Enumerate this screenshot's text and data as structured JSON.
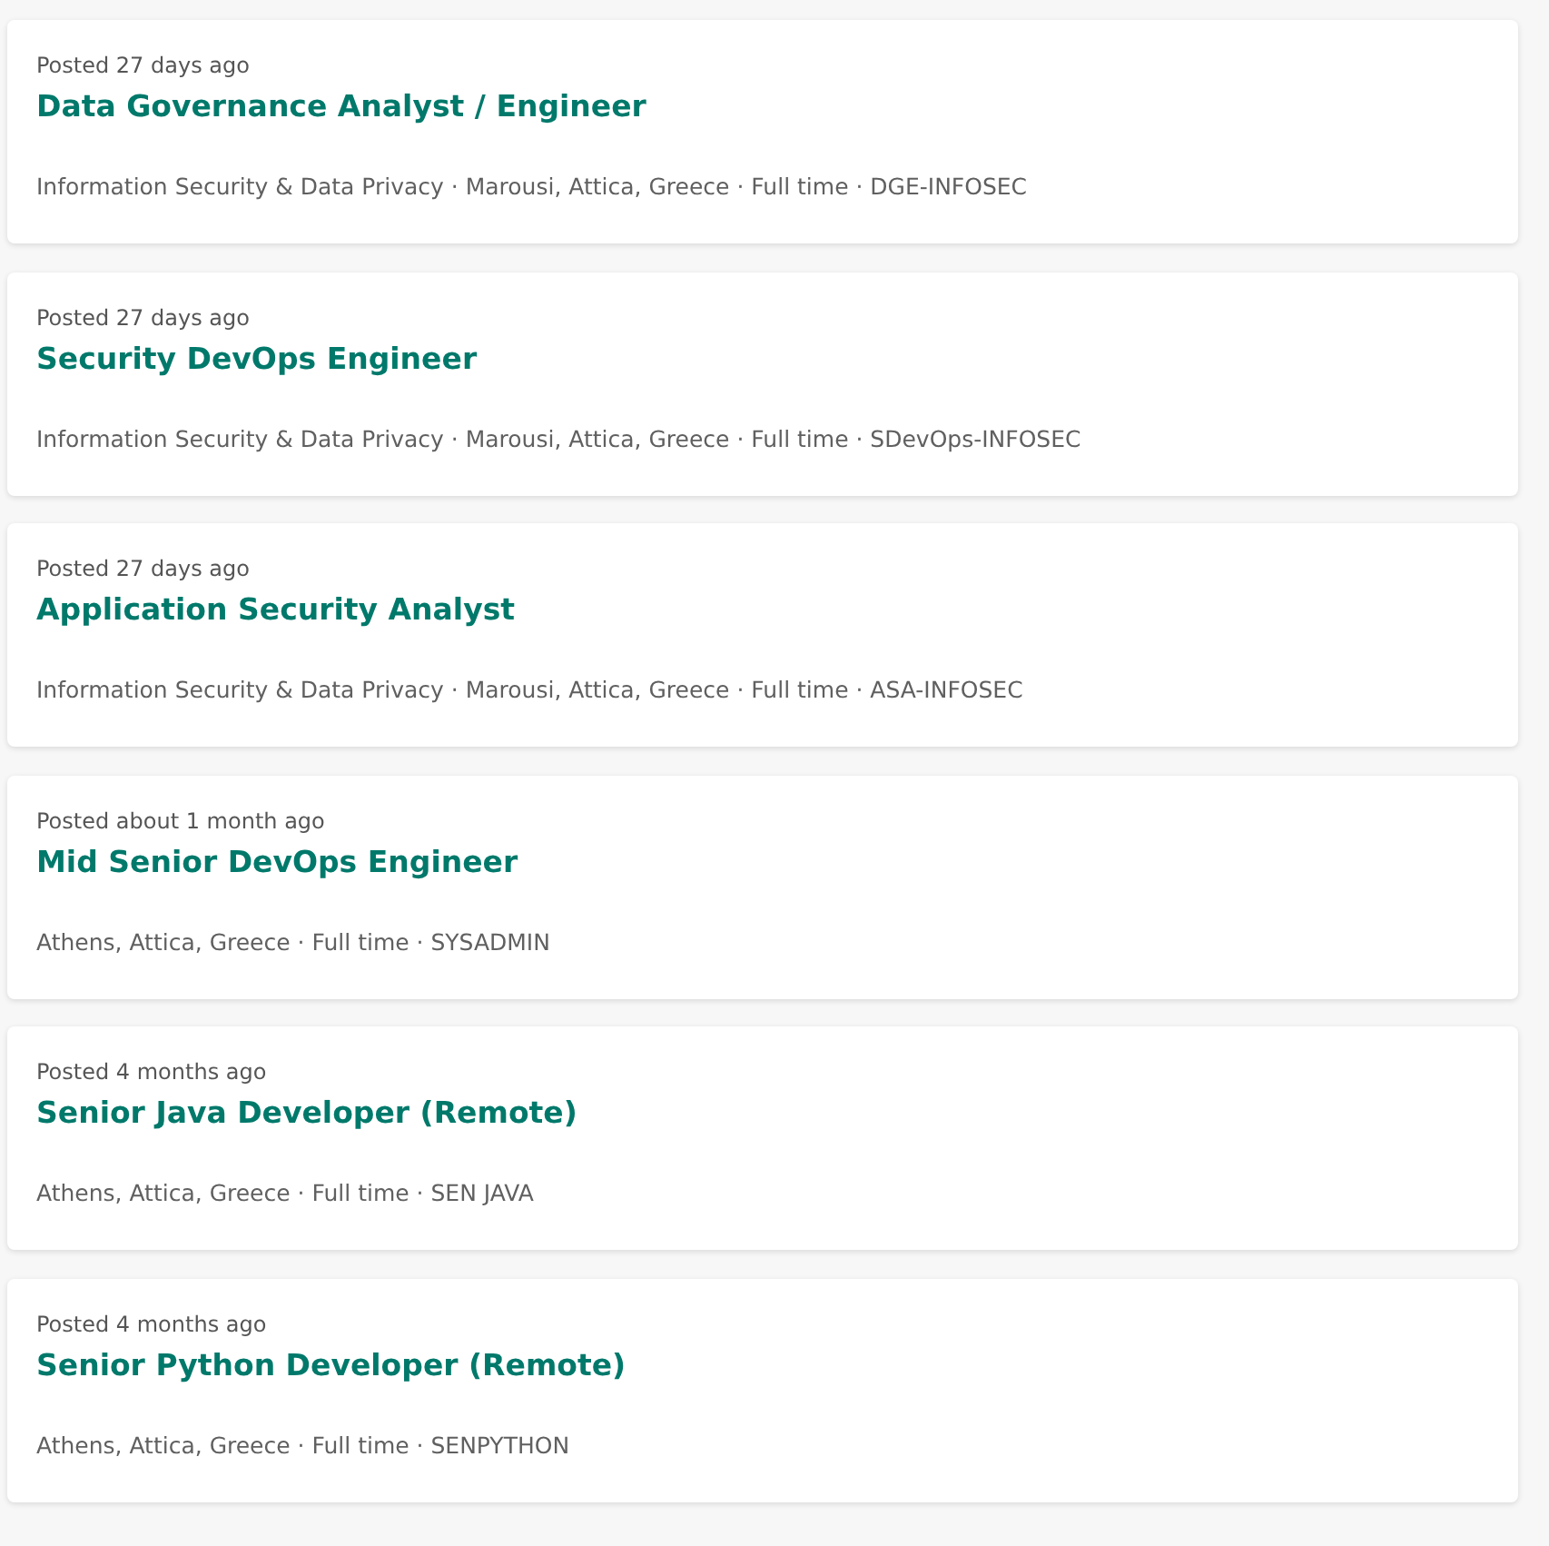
{
  "jobs": [
    {
      "posted": "Posted 27 days ago",
      "title": "Data Governance Analyst / Engineer",
      "meta": "Information Security & Data Privacy · Marousi, Attica, Greece · Full time · DGE-INFOSEC"
    },
    {
      "posted": "Posted 27 days ago",
      "title": "Security DevOps Engineer",
      "meta": "Information Security & Data Privacy · Marousi, Attica, Greece · Full time · SDevOps-INFOSEC"
    },
    {
      "posted": "Posted 27 days ago",
      "title": "Application Security Analyst",
      "meta": "Information Security & Data Privacy · Marousi, Attica, Greece · Full time · ASA-INFOSEC"
    },
    {
      "posted": "Posted about 1 month ago",
      "title": "Mid Senior DevOps Engineer",
      "meta": "Athens, Attica, Greece · Full time · SYSADMIN"
    },
    {
      "posted": "Posted 4 months ago",
      "title": "Senior Java Developer (Remote)",
      "meta": "Athens, Attica, Greece · Full time · SEN JAVA"
    },
    {
      "posted": "Posted 4 months ago",
      "title": "Senior Python Developer (Remote)",
      "meta": "Athens, Attica, Greece · Full time · SENPYTHON"
    }
  ]
}
